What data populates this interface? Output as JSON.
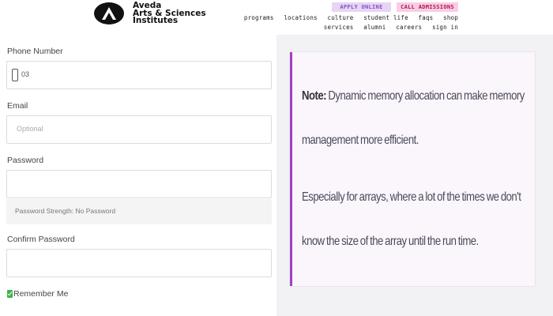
{
  "header": {
    "brand_lines": [
      "Aveda",
      "Arts & Sciences",
      "Institutes"
    ],
    "apply_label": "APPLY ONLINE",
    "call_label": "CALL ADMISSIONS",
    "nav_row1": [
      "programs",
      "locations",
      "culture",
      "student life",
      "faqs",
      "shop"
    ],
    "nav_row2": [
      "services",
      "alumni",
      "careers",
      "sign in"
    ],
    "colors": {
      "apply_bg": "#e7d5f5",
      "call_bg": "#f9cde6"
    }
  },
  "form": {
    "phone_label": "Phone Number",
    "phone_value": "03",
    "email_label": "Email",
    "email_placeholder": "Optional",
    "password_label": "Password",
    "password_strength": "Password Strength: No Password",
    "confirm_label": "Confirm Password",
    "remember_label": "Remember Me",
    "remember_checked": true
  },
  "note": {
    "label": "Note:",
    "text1": "Dynamic memory allocation can make memory management more efficient.",
    "text2": "Especially for arrays, where a lot of the times we don't know the size of the array until the run time.",
    "accent_color": "#a240c8"
  }
}
